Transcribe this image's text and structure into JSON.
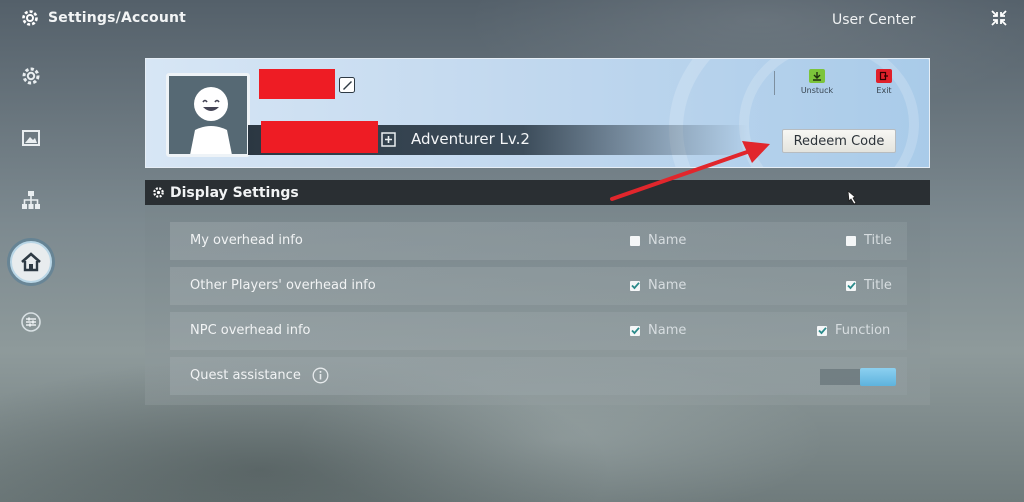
{
  "header": {
    "breadcrumb": "Settings/Account",
    "user_center": "User Center"
  },
  "sidebar": {
    "items": [
      {
        "name": "gear",
        "active": false
      },
      {
        "name": "image",
        "active": false
      },
      {
        "name": "network",
        "active": false
      },
      {
        "name": "home",
        "active": true
      },
      {
        "name": "sliders",
        "active": false
      }
    ]
  },
  "profile": {
    "level_text": "Adventurer Lv.2",
    "unstuck_label": "Unstuck",
    "exit_label": "Exit",
    "redeem_label": "Redeem Code"
  },
  "display_settings": {
    "title": "Display Settings",
    "rows": [
      {
        "label": "My overhead info",
        "opt1": "Name",
        "opt1_checked": false,
        "opt2": "Title",
        "opt2_checked": false
      },
      {
        "label": "Other Players' overhead info",
        "opt1": "Name",
        "opt1_checked": true,
        "opt2": "Title",
        "opt2_checked": true
      },
      {
        "label": "NPC overhead info",
        "opt1": "Name",
        "opt1_checked": true,
        "opt2": "Function",
        "opt2_checked": true
      },
      {
        "label": "Quest assistance",
        "toggle_on": true
      }
    ]
  },
  "colors": {
    "redaction": "#ee1c24",
    "unstuck_icon": "#7cc43a",
    "exit_icon": "#e0202a",
    "toggle_on": "#6cc0e6",
    "annotation_arrow": "#e1262c"
  }
}
